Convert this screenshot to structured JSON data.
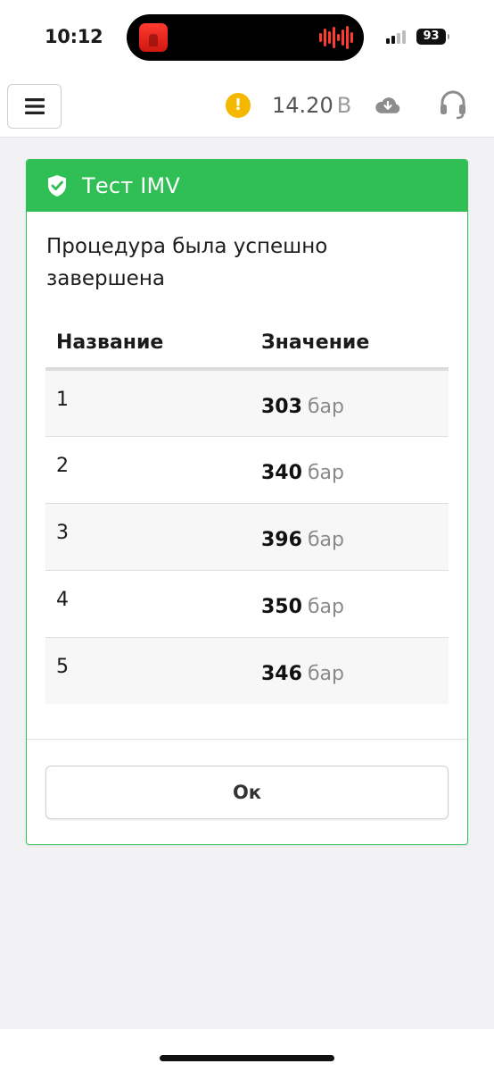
{
  "status_bar": {
    "time": "10:12",
    "battery": "93"
  },
  "header": {
    "voltage_value": "14.20",
    "voltage_unit": "В",
    "icons": [
      "menu-icon",
      "warning-icon",
      "cloud-download-icon",
      "headset-icon"
    ],
    "warning_color": "#f5b800"
  },
  "dialog": {
    "title": "Тест IMV",
    "header_color": "#2fbf55",
    "message": "Процедура была успешно завершена",
    "table": {
      "columns": [
        "Название",
        "Значение"
      ],
      "rows": [
        {
          "name": "1",
          "value": "303",
          "unit": "бар"
        },
        {
          "name": "2",
          "value": "340",
          "unit": "бар"
        },
        {
          "name": "3",
          "value": "396",
          "unit": "бар"
        },
        {
          "name": "4",
          "value": "350",
          "unit": "бар"
        },
        {
          "name": "5",
          "value": "346",
          "unit": "бар"
        }
      ]
    },
    "ok_label": "Ок"
  }
}
